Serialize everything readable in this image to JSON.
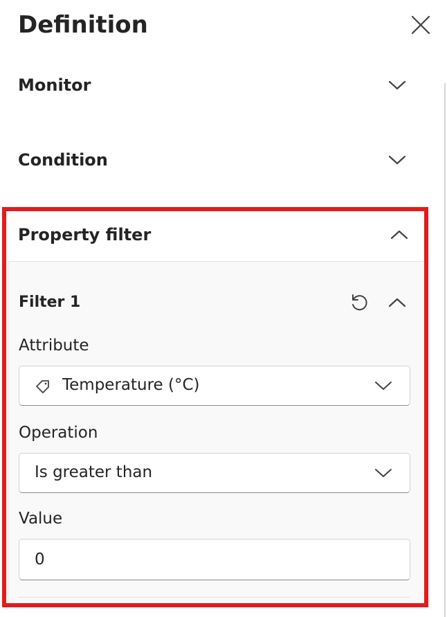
{
  "panel": {
    "title": "Definition"
  },
  "sections": {
    "monitor": "Monitor",
    "condition": "Condition",
    "property_filter": "Property filter"
  },
  "filter": {
    "title": "Filter 1",
    "attribute": {
      "label": "Attribute",
      "value": "Temperature (°C)"
    },
    "operation": {
      "label": "Operation",
      "value": "Is greater than"
    },
    "value": {
      "label": "Value",
      "current": "0"
    }
  },
  "colors": {
    "highlight": "#e31b1b",
    "card_background": "#f9f9f9",
    "text": "#242424"
  },
  "icons": {
    "close": "close-icon",
    "chevron_down": "chevron-down-icon",
    "chevron_up": "chevron-up-icon",
    "reset": "reset-icon",
    "tag": "tag-icon"
  }
}
